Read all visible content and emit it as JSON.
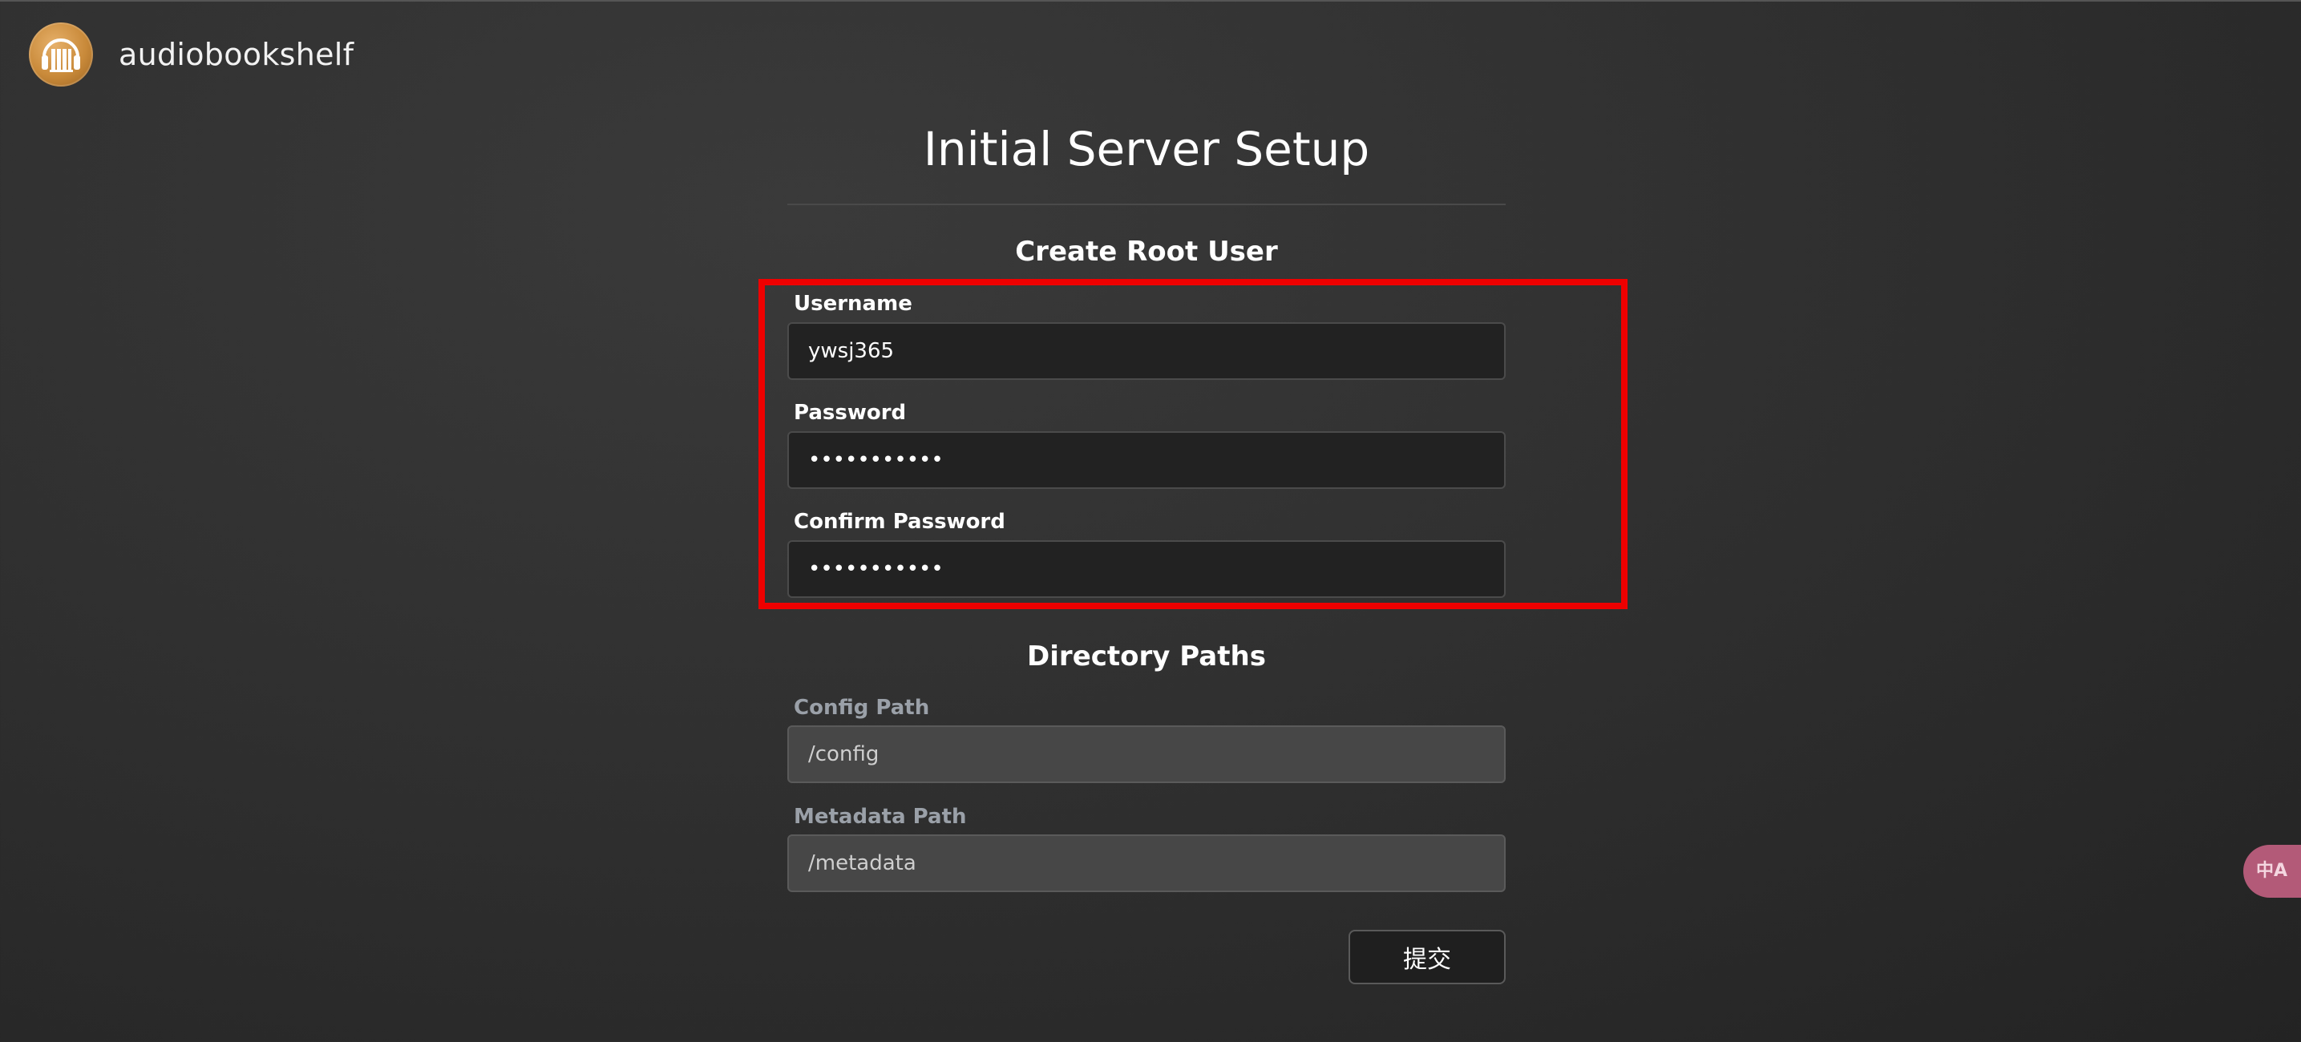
{
  "header": {
    "app_name": "audiobookshelf"
  },
  "page": {
    "title": "Initial Server Setup"
  },
  "root_user": {
    "section_title": "Create Root User",
    "username_label": "Username",
    "username_value": "ywsj365",
    "password_label": "Password",
    "password_value": "•••••••••••",
    "confirm_password_label": "Confirm Password",
    "confirm_password_value": "•••••••••••"
  },
  "directories": {
    "section_title": "Directory Paths",
    "config_label": "Config Path",
    "config_value": "/config",
    "metadata_label": "Metadata Path",
    "metadata_value": "/metadata"
  },
  "actions": {
    "submit_label": "提交"
  },
  "translate_widget": {
    "label": "中A"
  },
  "colors": {
    "highlight": "#ee0000",
    "logo": "#c98a3a",
    "translate_widget": "#b35a78"
  }
}
